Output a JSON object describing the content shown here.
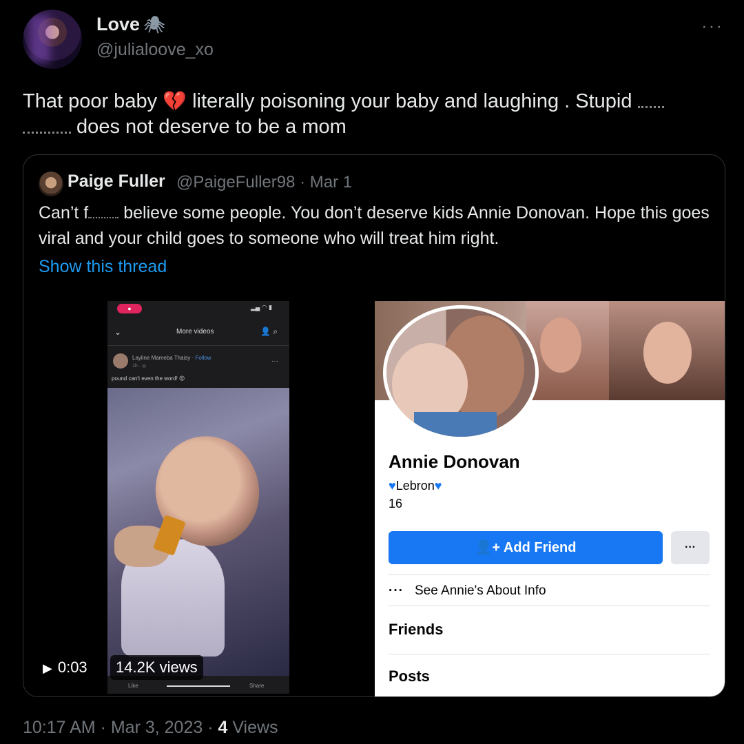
{
  "tweet": {
    "author_name": "Love",
    "author_badge_icon": "spider-icon",
    "author_handle": "@julialoove_xo",
    "text_part1": "That poor baby ",
    "text_part2": " literally poisoning your baby and laughing . Stupid ",
    "text_part3": " does not deserve to be a mom",
    "emoji": "broken-heart-icon",
    "timestamp": "10:17 AM · Mar 3, 2023 · ",
    "views_count": "4",
    "views_label": " Views"
  },
  "quote": {
    "author_name": "Paige Fuller",
    "author_handle": "@PaigeFuller98 · Mar 1",
    "text_part1": "Can’t f",
    "text_part2": " believe some people. You don’t deserve kids Annie Donovan. Hope this goes viral and your child goes to someone who will treat him right.",
    "show_thread": "Show this thread",
    "video_time": "0:03",
    "video_views": "14.2K views"
  },
  "phone_screen": {
    "title": "More videos",
    "poster": "Layline Mameba Thaisy · ",
    "follow": "Follow",
    "caption": "pound can't even the word! 😡",
    "footer_like": "Like",
    "footer_share": "Share"
  },
  "facebook": {
    "name": "Annie Donovan",
    "bio": "Lebron",
    "age": "16",
    "add_friend": "Add Friend",
    "more": "···",
    "about": "See Annie's About Info",
    "friends": "Friends",
    "posts": "Posts",
    "accent": "#1877f2"
  },
  "colors": {
    "background": "#000000",
    "link": "#1d9bf0",
    "muted": "#71767b"
  }
}
